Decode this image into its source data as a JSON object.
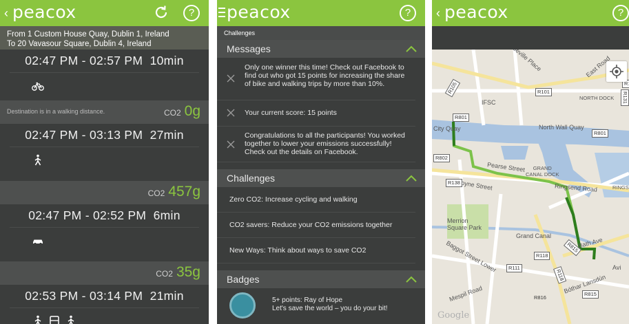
{
  "brand": "peacox",
  "back_chevron": "‹",
  "help_glyph": "?",
  "colors": {
    "accent": "#8bc53f",
    "panel_bg": "#3b3d3c",
    "map_route": "#2e7d1e"
  },
  "route": {
    "from": "From 1 Custom House Quay, Dublin 1, Ireland",
    "to": "To 20 Vavasour Square, Dublin 4, Ireland"
  },
  "trips": [
    {
      "time": "02:47 PM - 02:57 PM",
      "duration": "10min",
      "modes": [
        "bike-icon"
      ]
    },
    {
      "note": "Destination is in a walking distance.",
      "co2_label": "CO2",
      "co2_value": "0g",
      "time": "02:47 PM - 03:13 PM",
      "duration": "27min",
      "modes": [
        "walk-icon"
      ]
    },
    {
      "note": "",
      "co2_label": "CO2",
      "co2_value": "457g",
      "time": "02:47 PM - 02:52 PM",
      "duration": "6min",
      "modes": [
        "car-icon"
      ]
    },
    {
      "note": "",
      "co2_label": "CO2",
      "co2_value": "35g",
      "time": "02:53 PM - 03:14 PM",
      "duration": "21min",
      "modes": [
        "walk-icon",
        "bus-icon",
        "walk-icon"
      ]
    }
  ],
  "challenges_screen": {
    "subtitle": "Challenges",
    "messages_title": "Messages",
    "messages": [
      "Only one winner this time! Check out Facebook to find out who got 15 points for increasing the share of bike and walking trips by more than 10%.",
      "Your current score: 15 points",
      "Congratulations to all the participants! You worked together to lower your emissions successfully! Check out the details on Facebook."
    ],
    "challenges_title": "Challenges",
    "challenges": [
      "Zero CO2: Increase cycling and walking",
      "CO2 savers: Reduce your CO2 emissions together",
      "New Ways: Think about ways to save CO2"
    ],
    "badges_title": "Badges",
    "badge": {
      "title": "5+ points: Ray of Hope",
      "desc": "Let's save the world – you do your bit!"
    }
  },
  "map": {
    "labels": {
      "seville": "Seville Place",
      "east_road": "East Road",
      "ifsc": "IFSC",
      "north_dock": "NORTH DOCK",
      "north_wall": "North Wall Quay",
      "city_quay": "City Quay",
      "pearse": "Pearse Street",
      "grand_canal_dock": "GRAND\nCANAL DOCK",
      "ringsend": "Ringsend Road",
      "rings": "RINGS",
      "boyne": "Boyne Street",
      "merrion": "Merrion\nSquare Park",
      "grand_canal": "Grand Canal",
      "baggot": "Baggot Street Lower",
      "mespil": "Mespil Road",
      "bothar": "Bóthar Lansdún",
      "avi": "Avi",
      "bath": "Bath Ave",
      "google": "Google"
    },
    "road_numbers": [
      "R105",
      "R101",
      "R131",
      "R801",
      "R801",
      "R802",
      "R138",
      "R118",
      "R111",
      "R815",
      "R815",
      "R118",
      "R816",
      "R1"
    ]
  }
}
